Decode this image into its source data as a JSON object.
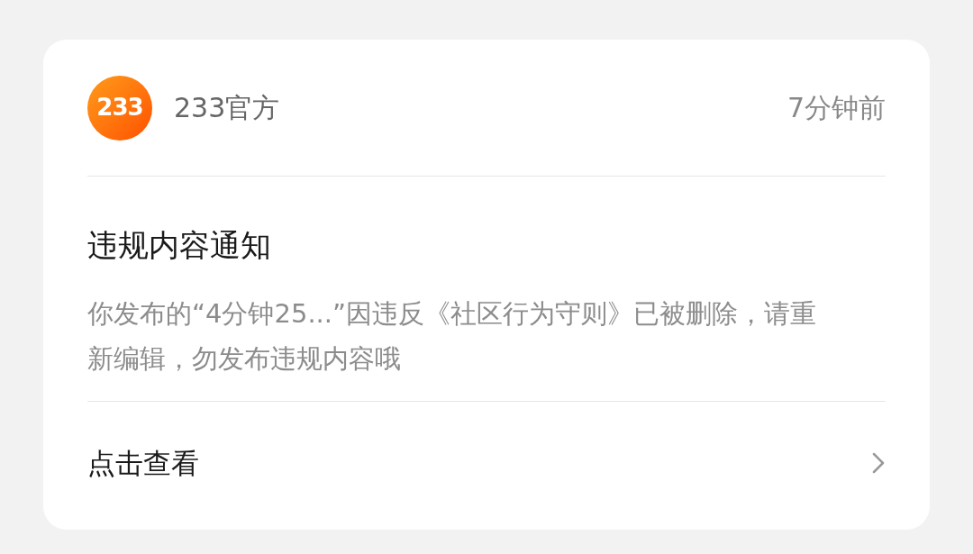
{
  "notification": {
    "logo_text": "233",
    "sender": "233官方",
    "time": "7分钟前",
    "title": "违规内容通知",
    "message": "你发布的“4分钟25...”因违反《社区行为守则》已被删除，请重新编辑，勿发布违规内容哦",
    "action": "点击查看"
  }
}
